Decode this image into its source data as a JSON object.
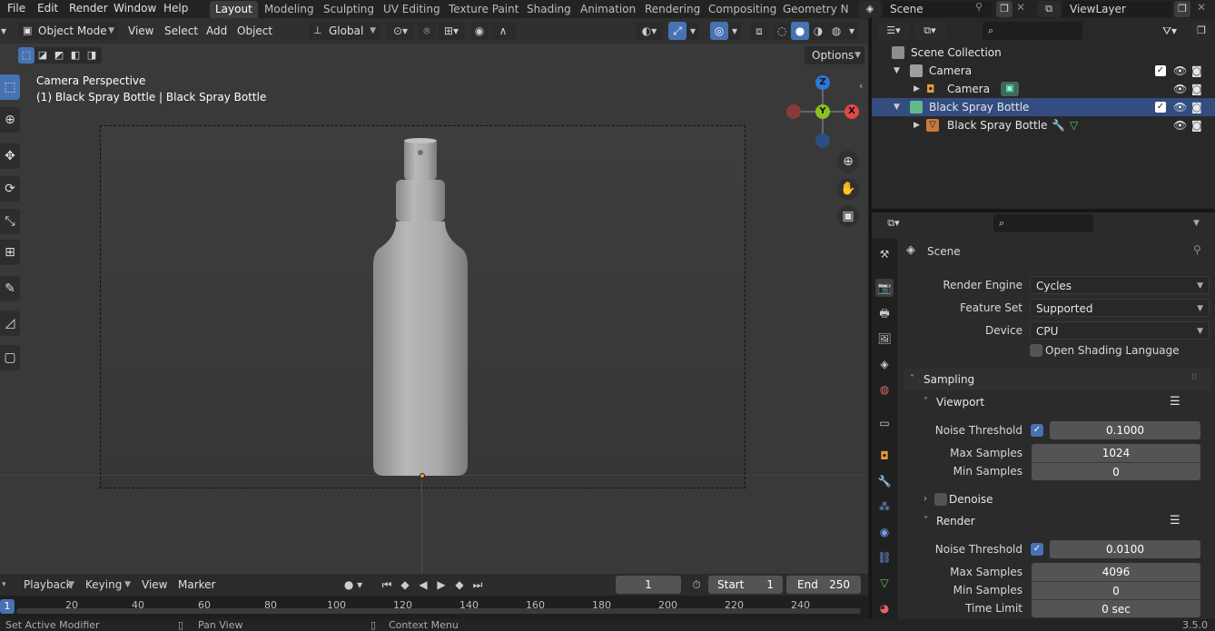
{
  "menu": {
    "file": "File",
    "edit": "Edit",
    "render": "Render",
    "window": "Window",
    "help": "Help"
  },
  "workspace_tabs": [
    "Layout",
    "Modeling",
    "Sculpting",
    "UV Editing",
    "Texture Paint",
    "Shading",
    "Animation",
    "Rendering",
    "Compositing",
    "Geometry Noc"
  ],
  "scene_selector": {
    "label": "Scene"
  },
  "viewlayer_selector": {
    "label": "ViewLayer"
  },
  "viewport_header": {
    "mode": "Object Mode",
    "view": "View",
    "select": "Select",
    "add": "Add",
    "object": "Object",
    "orientation": "Global",
    "options": "Options"
  },
  "viewport_overlay": {
    "line1": "Camera Perspective",
    "line2": "(1) Black Spray Bottle | Black Spray Bottle"
  },
  "gizmo": {
    "z": "Z",
    "y": "Y",
    "x": "X"
  },
  "timeline": {
    "playback": "Playback",
    "keying": "Keying",
    "view": "View",
    "marker": "Marker",
    "current_frame": "1",
    "start_label": "Start",
    "start_value": "1",
    "end_label": "End",
    "end_value": "250",
    "ticks": [
      "1",
      "20",
      "40",
      "60",
      "80",
      "100",
      "120",
      "140",
      "160",
      "180",
      "200",
      "220",
      "240"
    ]
  },
  "status_bar": {
    "left": "Set Active Modifier",
    "middle": "Pan View",
    "right": "Context Menu",
    "version": "3.5.0"
  },
  "outliner": {
    "collection": "Scene Collection",
    "rows": [
      {
        "label": "Camera",
        "type": "collection"
      },
      {
        "label": "Camera",
        "type": "camera-object"
      },
      {
        "label": "Black Spray Bottle",
        "type": "collection",
        "selected": true
      },
      {
        "label": "Black Spray Bottle",
        "type": "mesh-object"
      }
    ]
  },
  "properties": {
    "context": "Scene",
    "render_engine_label": "Render Engine",
    "render_engine": "Cycles",
    "feature_set_label": "Feature Set",
    "feature_set": "Supported",
    "device_label": "Device",
    "device": "CPU",
    "osl_label": "Open Shading Language",
    "sampling": "Sampling",
    "viewport": "Viewport",
    "render": "Render",
    "denoise": "Denoise",
    "noise_threshold_label": "Noise Threshold",
    "max_samples_label": "Max Samples",
    "min_samples_label": "Min Samples",
    "time_limit_label": "Time Limit",
    "viewport_noise_threshold": "0.1000",
    "viewport_max_samples": "1024",
    "viewport_min_samples": "0",
    "render_noise_threshold": "0.0100",
    "render_max_samples": "4096",
    "render_min_samples": "0",
    "render_time_limit": "0 sec"
  },
  "colors": {
    "accent": "#4772b3",
    "selection": "#334d80",
    "gizmo_x": "#e04848",
    "gizmo_y": "#8ac21f",
    "gizmo_z": "#2d78d6"
  }
}
